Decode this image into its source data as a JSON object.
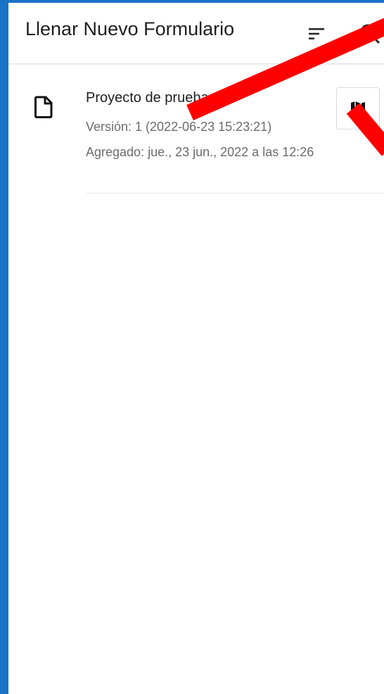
{
  "app_bar": {
    "title": "Llenar Nuevo Formulario",
    "sort_icon": "sort-icon",
    "search_icon": "search-icon"
  },
  "forms": [
    {
      "title": "Proyecto de prueba",
      "version": "Versión: 1 (2022-06-23 15:23:21)",
      "added": "Agregado: jue., 23 jun., 2022 a las 12:26",
      "icon": "document-icon",
      "action_icon": "map-icon"
    }
  ],
  "colors": {
    "frame": "#1a73c8",
    "annotation_arrow": "#ff0000",
    "text_primary": "#1f1f1f",
    "text_secondary": "#6b6b6b"
  }
}
